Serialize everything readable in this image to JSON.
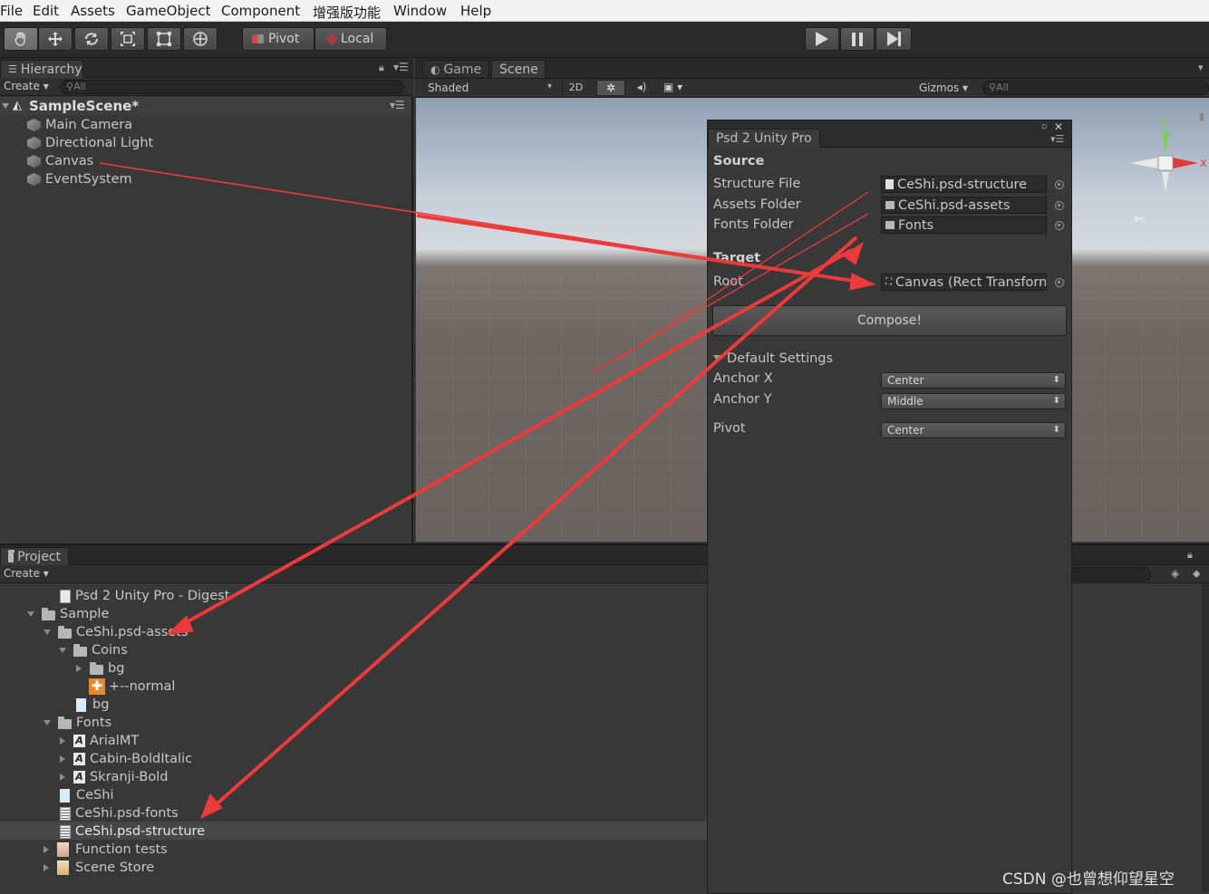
{
  "menu": [
    "File",
    "Edit",
    "Assets",
    "GameObject",
    "Component",
    "增强版功能",
    "Window",
    "Help"
  ],
  "toolbar": {
    "tools": [
      "hand-tool",
      "move-tool",
      "rotate-tool",
      "scale-tool",
      "rect-tool",
      "transform-tool"
    ],
    "pivot": "Pivot",
    "local": "Local"
  },
  "hierarchy": {
    "tab": "Hierarchy",
    "create": "Create",
    "search": "All",
    "scene": "SampleScene*",
    "items": [
      "Main Camera",
      "Directional Light",
      "Canvas",
      "EventSystem"
    ]
  },
  "sceneview": {
    "tabs": [
      "Game",
      "Scene"
    ],
    "shading": "Shaded",
    "mode_2d": "2D",
    "gizmos": "Gizmos",
    "search": "All",
    "axis_y": "y",
    "axis_x": "x"
  },
  "psd": {
    "title": "Psd 2 Unity Pro",
    "source_header": "Source",
    "structure_label": "Structure File",
    "structure_value": "CeShi.psd-structure",
    "assets_label": "Assets Folder",
    "assets_value": "CeShi.psd-assets",
    "fonts_label": "Fonts Folder",
    "fonts_value": "Fonts",
    "target_header": "Target",
    "root_label": "Root",
    "root_value": "Canvas (Rect Transforn",
    "compose": "Compose!",
    "defaults_header": "Default Settings",
    "anchor_x_label": "Anchor X",
    "anchor_x_value": "Center",
    "anchor_y_label": "Anchor Y",
    "anchor_y_value": "Middle",
    "pivot_label": "Pivot",
    "pivot_value": "Center"
  },
  "project": {
    "tab": "Project",
    "create": "Create",
    "items": [
      {
        "label": "Psd 2 Unity Pro - Digest",
        "icon": "document-icon"
      },
      {
        "label": "Sample",
        "icon": "folder-icon"
      },
      {
        "label": "CeShi.psd-assets",
        "icon": "folder-icon"
      },
      {
        "label": "Coins",
        "icon": "folder-icon"
      },
      {
        "label": "bg",
        "icon": "folder-icon"
      },
      {
        "label": "+--normal",
        "icon": "sprite-icon"
      },
      {
        "label": "bg",
        "icon": "image-icon"
      },
      {
        "label": "Fonts",
        "icon": "folder-icon"
      },
      {
        "label": "ArialMT",
        "icon": "font-icon"
      },
      {
        "label": "Cabin-BoldItalic",
        "icon": "font-icon"
      },
      {
        "label": "Skranji-Bold",
        "icon": "font-icon"
      },
      {
        "label": "CeShi",
        "icon": "image-icon"
      },
      {
        "label": "CeShi.psd-fonts",
        "icon": "text-asset-icon"
      },
      {
        "label": "CeShi.psd-structure",
        "icon": "text-asset-icon"
      },
      {
        "label": "Function tests",
        "icon": "scene-icon"
      },
      {
        "label": "Scene Store",
        "icon": "scene-icon"
      }
    ]
  },
  "watermark": "CSDN @也曾想仰望星空",
  "colors": {
    "annotation_arrow": "#ee3a3a",
    "panel_bg": "#383838",
    "toolbar_bg": "#2a2a2a"
  }
}
